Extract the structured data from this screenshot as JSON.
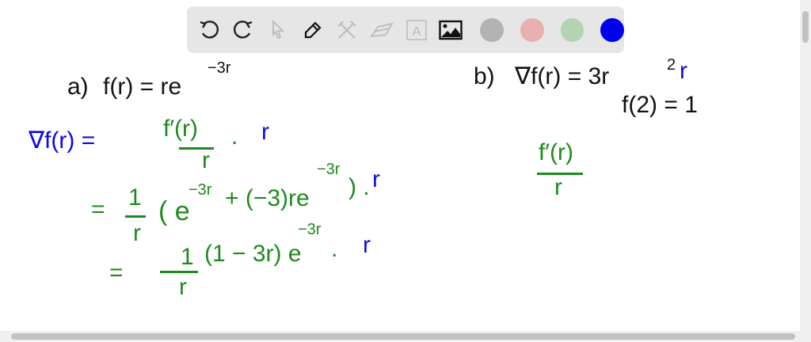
{
  "toolbar": {
    "tools": [
      "undo-icon",
      "redo-icon",
      "select-icon",
      "pen-icon",
      "tools-icon",
      "eraser-icon",
      "text-icon",
      "image-icon"
    ],
    "text_tool_label": "A",
    "colors": [
      "#b3b3b3",
      "#e8b0b0",
      "#b3d3b3",
      "#0000ee"
    ],
    "active_color": "#0000ee"
  },
  "part_a": {
    "label": "a)",
    "definition": "f(r) = re",
    "definition_exp": "−3r",
    "grad_lhs": "∇f(r) =",
    "fraction_num": "f′(r)",
    "fraction_den": "r",
    "dot": ".",
    "r_vec": "r",
    "step1_eq": "=",
    "step1_num": "1",
    "step1_den": "r",
    "step1_body_a": "( e",
    "step1_exp_a": "−3r",
    "step1_body_b": "+ (−3)re",
    "step1_exp_b": "−3r",
    "step1_close": ") .",
    "step2_eq": "=",
    "step2_num": "1",
    "step2_den": "r",
    "step2_body": "(1 − 3r) e",
    "step2_exp": "−3r",
    "step2_dot": "."
  },
  "part_b": {
    "label": "b)",
    "grad": "∇f(r) = 3r",
    "grad_sq": "2",
    "r_vec": "r",
    "condition": "f(2) = 1",
    "fraction_num": "f′(r)",
    "fraction_den": "r"
  }
}
